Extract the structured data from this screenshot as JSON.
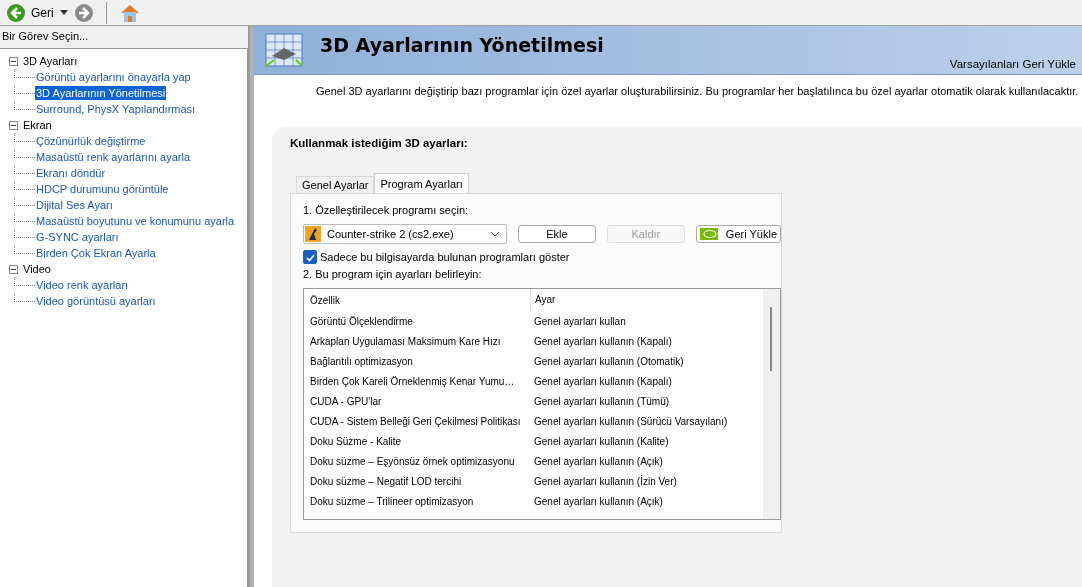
{
  "toolbar": {
    "back_label": "Geri"
  },
  "sidebar": {
    "title": "Bir Görev Seçin...",
    "tree": [
      {
        "label": "3D Ayarları",
        "expanded": true,
        "children": [
          {
            "label": "Görüntü ayarlarını önayarla yap",
            "selected": false
          },
          {
            "label": "3D Ayarlarının Yönetilmesi",
            "selected": true
          },
          {
            "label": "Surround, PhysX Yapılandırması",
            "selected": false
          }
        ]
      },
      {
        "label": "Ekran",
        "expanded": true,
        "children": [
          {
            "label": "Çözünürlük değiştirme",
            "selected": false
          },
          {
            "label": "Masaüstü renk ayarlarını ayarla",
            "selected": false
          },
          {
            "label": "Ekranı döndür",
            "selected": false
          },
          {
            "label": "HDCP durumunu görüntüle",
            "selected": false
          },
          {
            "label": "Dijital Ses Ayarı",
            "selected": false
          },
          {
            "label": "Masaüstü boyutunu ve konumunu ayarla",
            "selected": false
          },
          {
            "label": "G-SYNC ayarları",
            "selected": false
          },
          {
            "label": "Birden Çok Ekran Ayarla",
            "selected": false
          }
        ]
      },
      {
        "label": "Video",
        "expanded": true,
        "children": [
          {
            "label": "Video renk ayarları",
            "selected": false
          },
          {
            "label": "Video görüntüsü ayarları",
            "selected": false
          }
        ]
      }
    ]
  },
  "header": {
    "title": "3D Ayarlarının Yönetilmesi",
    "restore_link": "Varsayılanları Geri Yükle"
  },
  "description": "Genel 3D ayarlarını değiştirip bazı programlar için özel ayarlar oluşturabilirsiniz. Bu programlar her başlatılınca bu özel ayarlar otomatik olarak kullanılacaktır.",
  "panel": {
    "title": "Kullanmak istediğim 3D ayarları:",
    "tabs": [
      {
        "label": "Genel Ayarlar",
        "selected": false
      },
      {
        "label": "Program Ayarları",
        "selected": true
      }
    ],
    "step1": "1. Özelleştirilecek programı seçin:",
    "program": "Counter-strike 2 (cs2.exe)",
    "buttons": [
      {
        "label": "Ekle",
        "disabled": false,
        "kind": "plain"
      },
      {
        "label": "Kaldır",
        "disabled": true,
        "kind": "plain"
      },
      {
        "label": "Geri Yükle",
        "disabled": false,
        "kind": "logo"
      }
    ],
    "show_local": {
      "label": "Sadece bu bilgisayarda bulunan programları göster",
      "checked": true
    },
    "step2": "2. Bu program için ayarları belirleyin:",
    "table": {
      "columns": [
        "Özellik",
        "Ayar"
      ],
      "rows": [
        [
          "Görüntü Ölçeklendirme",
          "Genel ayarları kullan"
        ],
        [
          "Arkaplan Uygulaması Maksimum Kare Hızı",
          "Genel ayarları kullanın (Kapalı)"
        ],
        [
          "Bağlantılı optimizasyon",
          "Genel ayarları kullanın (Otomatik)"
        ],
        [
          "Birden Çok Kareli Örneklenmiş Kenar Yumu…",
          "Genel ayarları kullanın (Kapalı)"
        ],
        [
          "CUDA - GPU'lar",
          "Genel ayarları kullanın (Tümü)"
        ],
        [
          "CUDA - Sistem Belleği Geri Çekilmesi Politikası",
          "Genel ayarları kullanın (Sürücü Varsayılanı)"
        ],
        [
          "Doku Süzme - Kalite",
          "Genel ayarları kullanın (Kalite)"
        ],
        [
          "Doku süzme – Eşyönsüz örnek optimizasyonu",
          "Genel ayarları kullanın (Açık)"
        ],
        [
          "Doku süzme – Negatif LOD tercihi",
          "Genel ayarları kullanın (İzin Ver)"
        ],
        [
          "Doku süzme – Trilineer optimizasyon",
          "Genel ayarları kullanın (Açık)"
        ]
      ]
    }
  }
}
